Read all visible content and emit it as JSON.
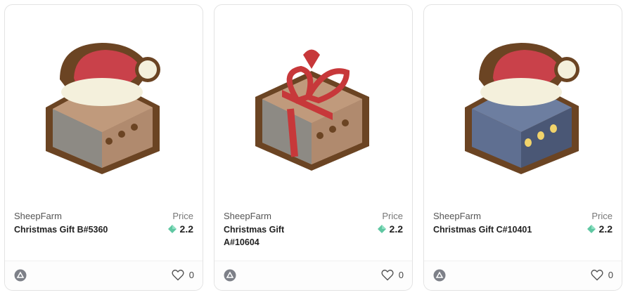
{
  "cards": [
    {
      "collection": "SheepFarm",
      "name": "Christmas Gift B#5360",
      "price_label": "Price",
      "price": "2.2",
      "likes": "0",
      "art": "gift-box-santa-hat-brown-icon"
    },
    {
      "collection": "SheepFarm",
      "name": "Christmas Gift A#10604",
      "price_label": "Price",
      "price": "2.2",
      "likes": "0",
      "art": "gift-box-red-ribbon-icon"
    },
    {
      "collection": "SheepFarm",
      "name": "Christmas Gift C#10401",
      "price_label": "Price",
      "price": "2.2",
      "likes": "0",
      "art": "gift-box-santa-hat-blue-icon"
    }
  ],
  "colors": {
    "outline": "#6b4423",
    "brown_box": "#b08a6e",
    "blue_box": "#5a6b8c",
    "hat_red": "#c9414a",
    "fur": "#f4f0dc",
    "ribbon": "#c7383a",
    "gem": "#5fc7a2"
  },
  "icons": {
    "chain": "chain-logo-icon",
    "like": "heart-icon",
    "currency": "gem-icon"
  }
}
